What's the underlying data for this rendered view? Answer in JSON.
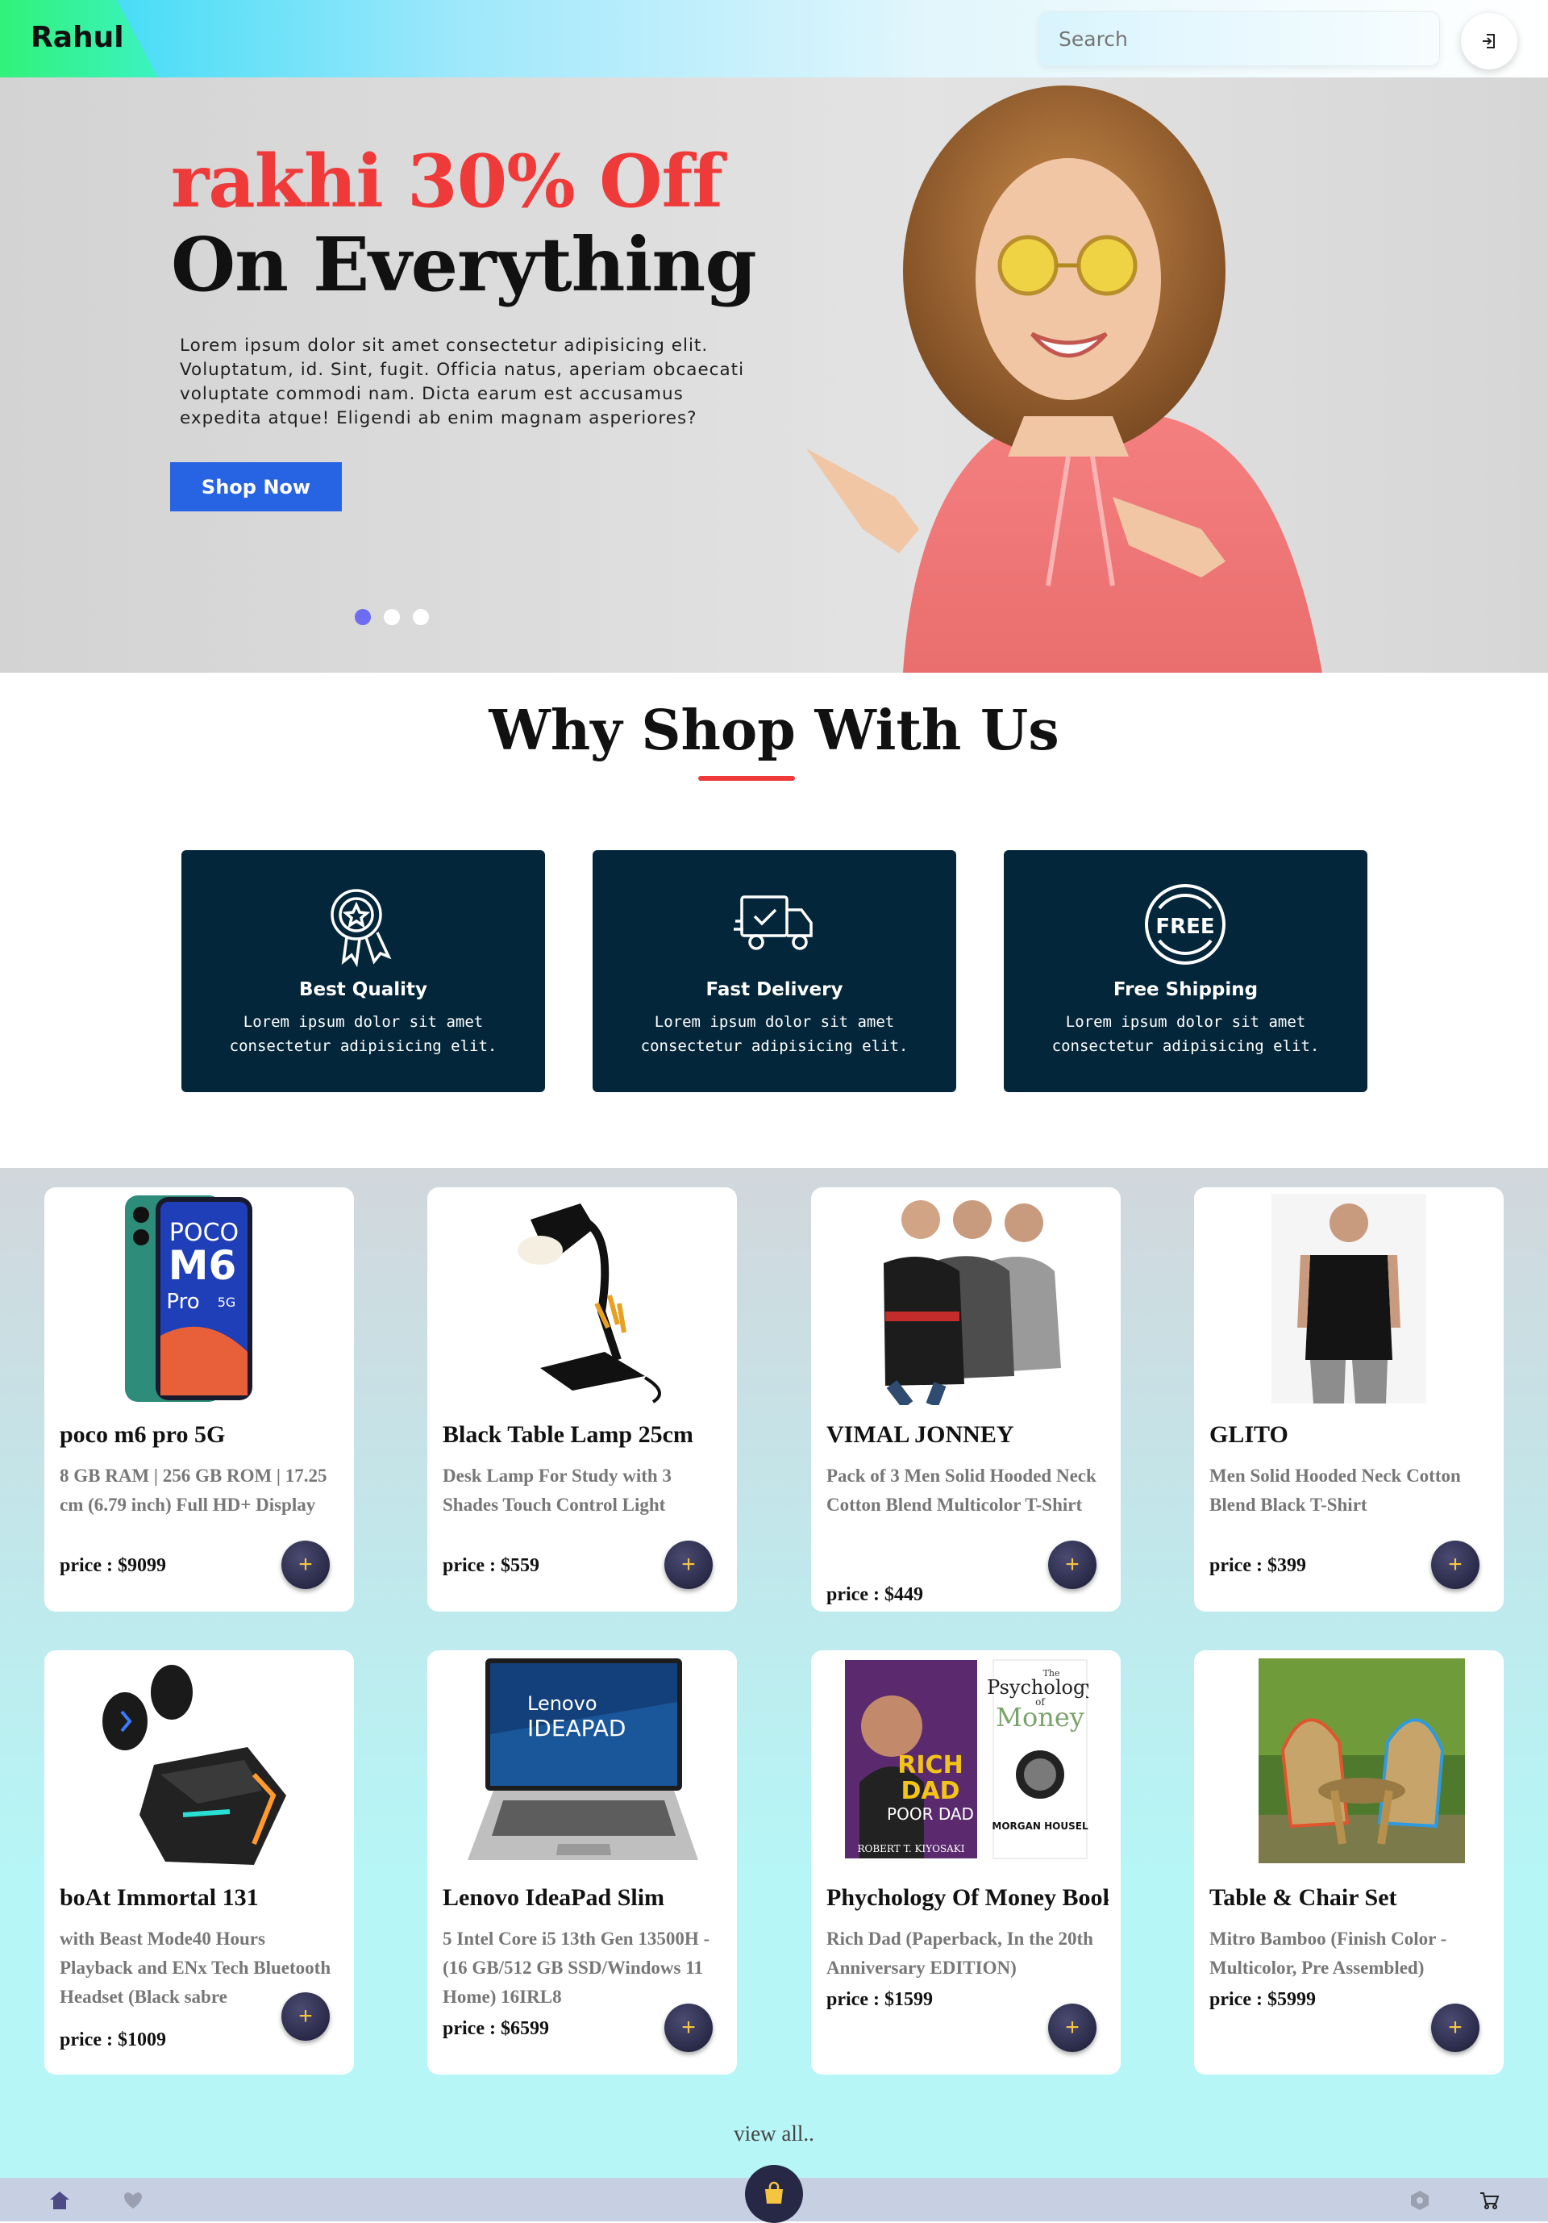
{
  "navbar": {
    "brand": "Rahul",
    "search_placeholder": "Search",
    "login_icon": "login-icon"
  },
  "hero": {
    "headline": "rakhi 30% Off",
    "subheadline": "On Everything",
    "description": "Lorem ipsum dolor sit amet consectetur adipisicing elit. Voluptatum, id. Sint, fugit. Officia natus, aperiam obcaecati voluptate commodi nam. Dicta earum est accusamus expedita atque! Eligendi ab enim magnam asperiores?",
    "cta_label": "Shop Now",
    "slides": 3,
    "active_slide": 1
  },
  "why": {
    "title": "Why Shop With Us",
    "features": [
      {
        "icon": "award-badge-icon",
        "title": "Best Quality",
        "text": "Lorem ipsum dolor sit amet consectetur adipisicing elit."
      },
      {
        "icon": "delivery-truck-icon",
        "title": "Fast Delivery",
        "text": "Lorem ipsum dolor sit amet consectetur adipisicing elit."
      },
      {
        "icon": "free-badge-icon",
        "title": "Free Shipping",
        "text": "Lorem ipsum dolor sit amet consectetur adipisicing elit.",
        "badge_text": "FREE"
      }
    ]
  },
  "products": [
    {
      "name": "poco m6 pro 5G",
      "desc": "8 GB RAM | 256 GB ROM | 17.25 cm (6.79 inch) Full HD+ Display",
      "price": "price : $9099",
      "image": "phone-image",
      "phone_text": [
        "POCO",
        "M6",
        "Pro",
        "5G"
      ]
    },
    {
      "name": "Black Table Lamp 25cm",
      "desc": "Desk Lamp For Study with 3 Shades Touch Control Light",
      "price": "price : $559",
      "image": "lamp-image"
    },
    {
      "name": "VIMAL JONNEY",
      "desc": "Pack of 3 Men Solid Hooded Neck Cotton Blend Multicolor T-Shirt",
      "price": "price : $449",
      "image": "hoodies-image"
    },
    {
      "name": "GLITO",
      "desc": "Men Solid Hooded Neck Cotton Blend Black T-Shirt",
      "price": "price : $399",
      "image": "sleeveless-hoodie-image"
    },
    {
      "name": "boAt Immortal 131",
      "desc": "with Beast Mode40 Hours Playback and ENx Tech Bluetooth Headset (Black sabre",
      "price": "price : $1009",
      "image": "earbuds-image"
    },
    {
      "name": "Lenovo IdeaPad Slim",
      "desc": "5 Intel Core i5 13th Gen 13500H - (16 GB/512 GB SSD/Windows 11 Home) 16IRL8",
      "price": "price : $6599",
      "image": "laptop-image",
      "laptop_text": [
        "Lenovo",
        "IDEAPAD"
      ]
    },
    {
      "name": "Phychology Of Money Book",
      "desc": "Rich Dad (Paperback, In the 20th Anniversary EDITION)",
      "price": "price : $1599",
      "image": "books-image",
      "book_text": [
        "RICH",
        "DAD",
        "POOR DAD",
        "ROBERT T. KIYOSAKI",
        "The",
        "Psychology",
        "of",
        "Money",
        "MORGAN HOUSEL"
      ]
    },
    {
      "name": "Table & Chair Set",
      "desc": "Mitro Bamboo (Finish Color - Multicolor, Pre Assembled)",
      "price": "price : $5999",
      "image": "bamboo-chairs-image"
    }
  ],
  "add_label": "+",
  "view_all": "view all..",
  "bottom_nav": {
    "icons": [
      "home-icon",
      "heart-icon",
      "shopping-bag-icon",
      "settings-icon",
      "cart-icon"
    ]
  }
}
